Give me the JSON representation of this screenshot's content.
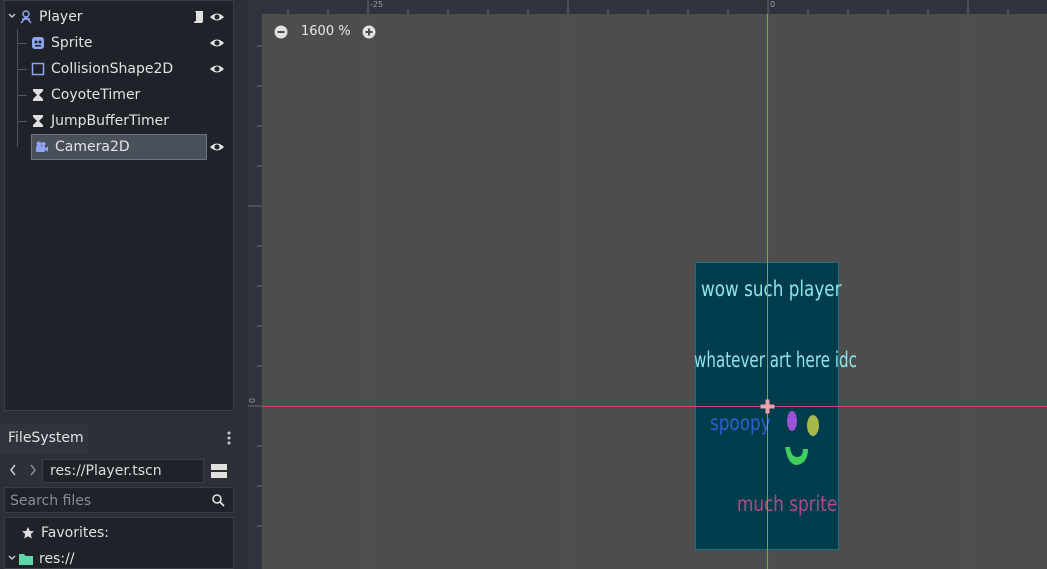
{
  "scene_tree": {
    "root": {
      "label": "Player",
      "icon": "node2d-icon"
    },
    "children": [
      {
        "label": "Sprite",
        "icon": "sprite-icon",
        "visible_toggle": true
      },
      {
        "label": "CollisionShape2D",
        "icon": "collision-shape-icon",
        "visible_toggle": true
      },
      {
        "label": "CoyoteTimer",
        "icon": "timer-icon",
        "visible_toggle": false
      },
      {
        "label": "JumpBufferTimer",
        "icon": "timer-icon",
        "visible_toggle": false
      },
      {
        "label": "Camera2D",
        "icon": "camera-icon",
        "visible_toggle": true,
        "selected": true
      }
    ]
  },
  "filesystem": {
    "tab_label": "FileSystem",
    "path": "res://Player.tscn",
    "search_placeholder": "Search files",
    "favorites_label": "Favorites:",
    "root_label": "res://"
  },
  "viewport": {
    "zoom_label": "1600 %",
    "ruler_labels": {
      "top_neg": "-25",
      "top_zero": "0",
      "left_zero": "0"
    },
    "sprite_texts": {
      "line1": "wow such player",
      "line2": "whatever art here idc",
      "line3": "spoopy",
      "line4": "much sprite"
    }
  },
  "colors": {
    "editor_bg": "#202531",
    "panel_bg": "#2c2f36",
    "viewport_bg": "#4d4d4d",
    "sprite_bg": "#003d4c",
    "axis_x": "#c04a64",
    "axis_y": "#7fa34a",
    "accent_icon": "#8da5f3"
  }
}
